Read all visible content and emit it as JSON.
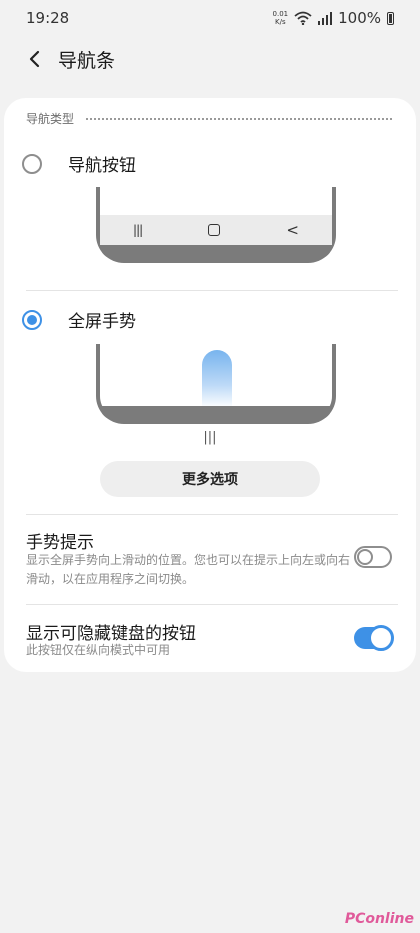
{
  "status_bar": {
    "time": "19:28",
    "speed_value": "0.01",
    "speed_unit": "K/s",
    "battery": "100%"
  },
  "header": {
    "title": "导航条"
  },
  "section": {
    "nav_type_label": "导航类型"
  },
  "options": [
    {
      "label": "导航按钮",
      "selected": false
    },
    {
      "label": "全屏手势",
      "selected": true
    }
  ],
  "nav_buttons_preview": {
    "recents_glyph": "|||",
    "back_glyph": "<"
  },
  "gesture_preview": {
    "handle_glyph": "|||"
  },
  "more_options_button": "更多选项",
  "settings": [
    {
      "title": "手势提示",
      "description": "显示全屏手势向上滑动的位置。您也可以在提示上向左或向右滑动，以在应用程序之间切换。",
      "enabled": false
    },
    {
      "title": "显示可隐藏键盘的按钮",
      "description": "此按钮仅在纵向模式中可用",
      "enabled": true
    }
  ],
  "colors": {
    "accent": "#3e91e6",
    "background": "#f2f2f2",
    "card": "#ffffff"
  },
  "watermark": "PConline"
}
